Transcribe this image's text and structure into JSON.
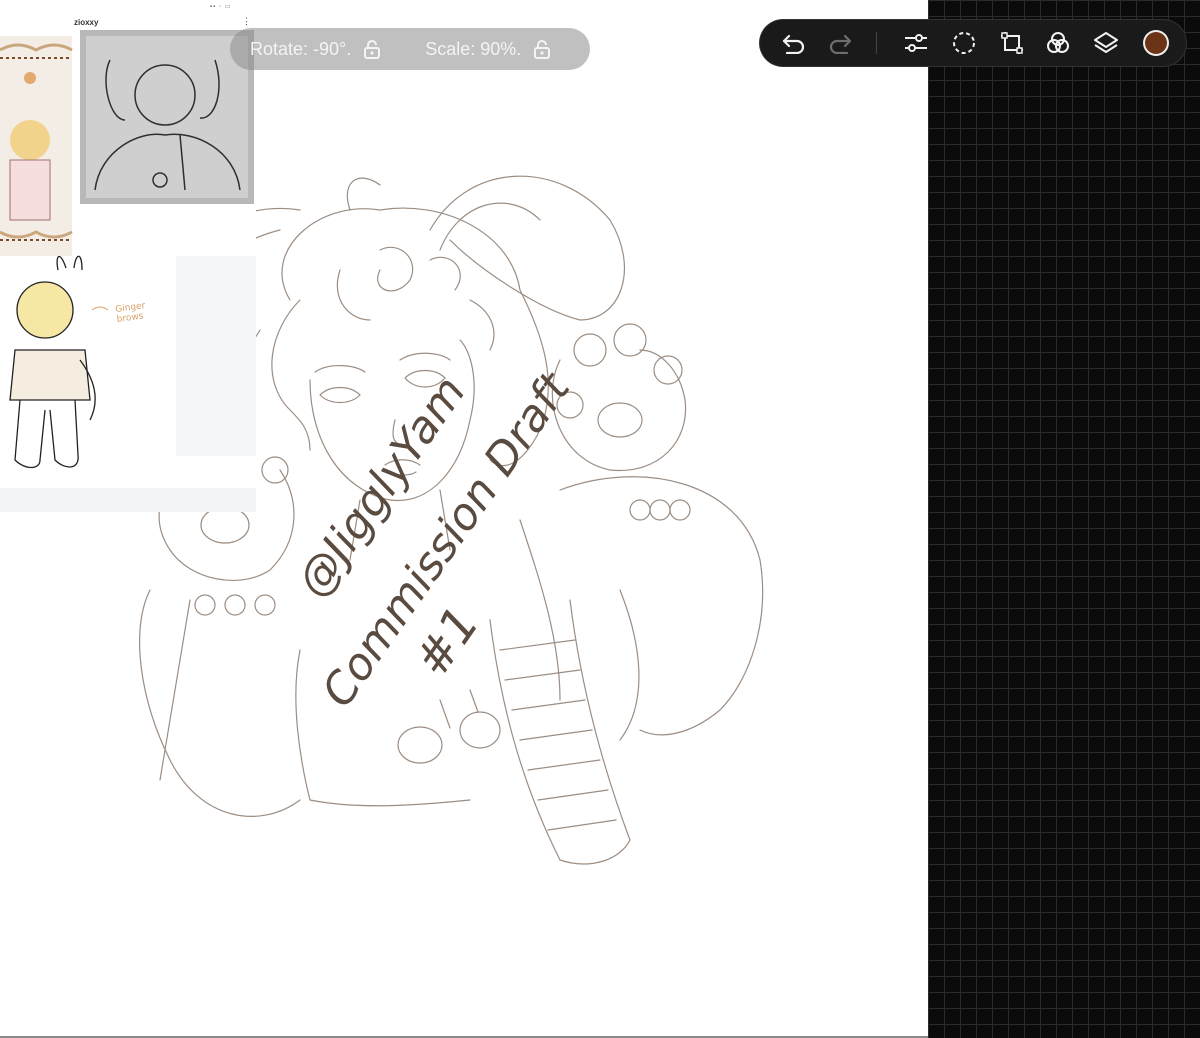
{
  "transform": {
    "rotate_label": "Rotate: -90°.",
    "scale_label": "Scale: 90%."
  },
  "reference": {
    "username": "zioxxy",
    "menu_glyph": "⋮",
    "note_line1": "Ginger",
    "note_line2": "brows"
  },
  "toolbar": {
    "icons": [
      "undo-icon",
      "redo-icon",
      "adjustments-icon",
      "selection-icon",
      "transform-icon",
      "blend-icon",
      "layers-icon"
    ],
    "current_color": "#6b3417"
  },
  "watermark": {
    "line1": "@JigglyYam",
    "line2": "Commission Draft",
    "line3": "#1"
  },
  "colors": {
    "sketch_line": "#8a7a6e",
    "watermark_text": "#5a4b40",
    "reference_fill": "#f3ede6",
    "toolbar_bg": "#1a1a1a"
  }
}
